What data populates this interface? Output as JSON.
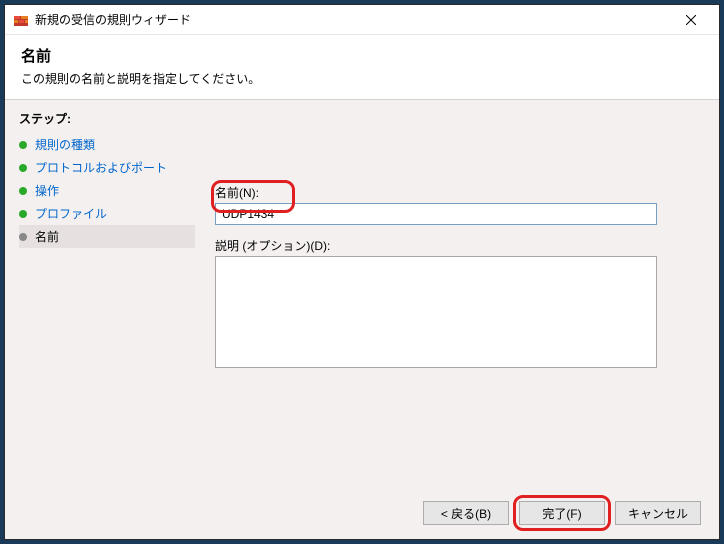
{
  "titlebar": {
    "title": "新規の受信の規則ウィザード"
  },
  "header": {
    "title": "名前",
    "subtitle": "この規則の名前と説明を指定してください。"
  },
  "sidebar": {
    "heading": "ステップ:",
    "steps": [
      {
        "label": "規則の種類"
      },
      {
        "label": "プロトコルおよびポート"
      },
      {
        "label": "操作"
      },
      {
        "label": "プロファイル"
      },
      {
        "label": "名前"
      }
    ]
  },
  "content": {
    "name_label": "名前(N):",
    "name_value": "UDP1434",
    "desc_label": "説明 (オプション)(D):",
    "desc_value": ""
  },
  "footer": {
    "back": "< 戻る(B)",
    "finish": "完了(F)",
    "cancel": "キャンセル"
  }
}
